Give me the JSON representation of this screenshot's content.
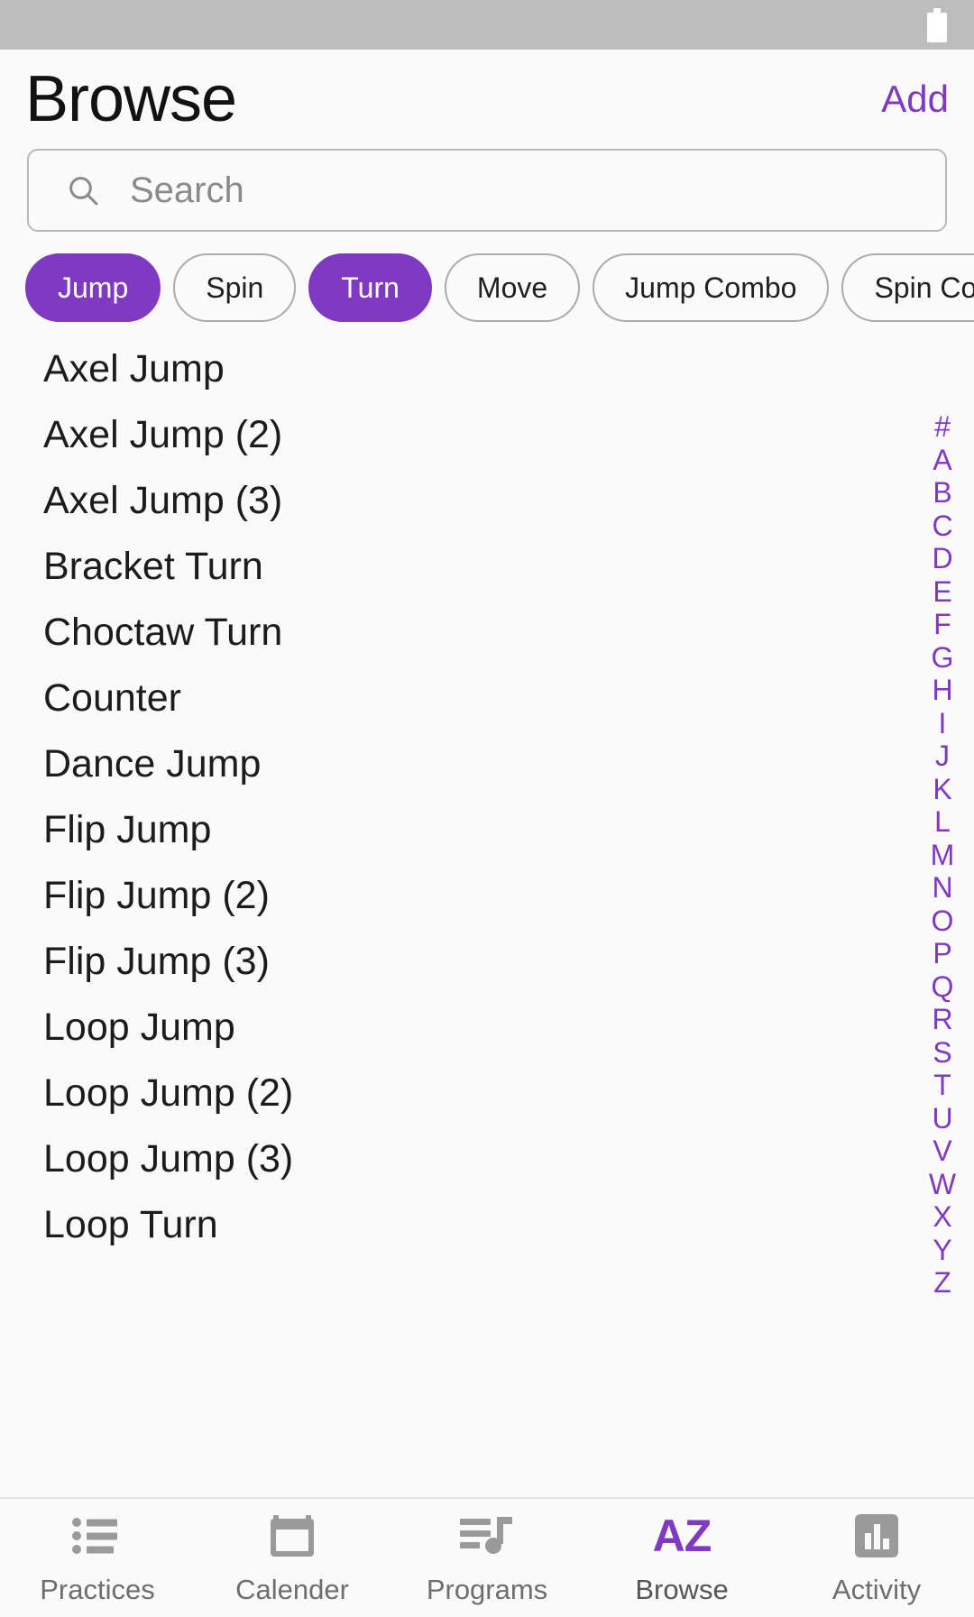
{
  "statusbar": {
    "battery_icon": "battery-icon"
  },
  "header": {
    "title": "Browse",
    "add_label": "Add"
  },
  "search": {
    "icon": "search-icon",
    "placeholder": "Search",
    "value": ""
  },
  "filters": {
    "chips": [
      {
        "label": "Jump",
        "selected": true
      },
      {
        "label": "Spin",
        "selected": false
      },
      {
        "label": "Turn",
        "selected": true
      },
      {
        "label": "Move",
        "selected": false
      },
      {
        "label": "Jump Combo",
        "selected": false
      },
      {
        "label": "Spin Combo",
        "selected": false
      },
      {
        "label": "",
        "selected": false
      }
    ]
  },
  "list": {
    "items": [
      "Axel Jump",
      "Axel Jump (2)",
      "Axel Jump (3)",
      "Bracket Turn",
      "Choctaw Turn",
      "Counter",
      "Dance Jump",
      "Flip Jump",
      "Flip Jump (2)",
      "Flip Jump (3)",
      "Loop Jump",
      "Loop Jump (2)",
      "Loop Jump (3)",
      "Loop Turn"
    ]
  },
  "index": {
    "letters": [
      "#",
      "A",
      "B",
      "C",
      "D",
      "E",
      "F",
      "G",
      "H",
      "I",
      "J",
      "K",
      "L",
      "M",
      "N",
      "O",
      "P",
      "Q",
      "R",
      "S",
      "T",
      "U",
      "V",
      "W",
      "X",
      "Y",
      "Z"
    ]
  },
  "tabbar": {
    "tabs": [
      {
        "label": "Practices",
        "icon": "list-bullets-icon",
        "active": false
      },
      {
        "label": "Calender",
        "icon": "calendar-icon",
        "active": false
      },
      {
        "label": "Programs",
        "icon": "music-list-icon",
        "active": false
      },
      {
        "label": "Browse",
        "icon": "az-icon",
        "active": true
      },
      {
        "label": "Activity",
        "icon": "bar-chart-icon",
        "active": false
      }
    ]
  },
  "colors": {
    "accent": "#8039c2",
    "statusbar": "#bdbdbd",
    "background": "#fafafa",
    "text": "#1c1c1c",
    "muted": "#8a8a8a"
  }
}
